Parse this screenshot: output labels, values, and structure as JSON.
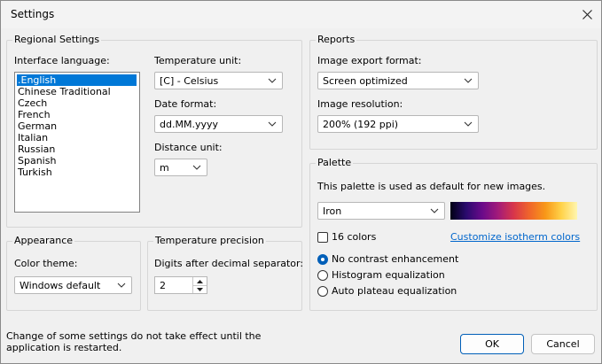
{
  "window": {
    "title": "Settings"
  },
  "regional": {
    "group_label": "Regional Settings",
    "language_label": "Interface language:",
    "languages": [
      ".English",
      "Chinese Traditional",
      "Czech",
      "French",
      "German",
      "Italian",
      "Russian",
      "Spanish",
      "Turkish"
    ],
    "temp_unit_label": "Temperature unit:",
    "temp_unit_value": "[C] - Celsius",
    "date_format_label": "Date format:",
    "date_format_value": "dd.MM.yyyy",
    "distance_unit_label": "Distance unit:",
    "distance_unit_value": "m"
  },
  "appearance": {
    "group_label": "Appearance",
    "theme_label": "Color theme:",
    "theme_value": "Windows default"
  },
  "precision": {
    "group_label": "Temperature precision",
    "digits_label": "Digits after decimal separator:",
    "digits_value": "2"
  },
  "reports": {
    "group_label": "Reports",
    "export_label": "Image export format:",
    "export_value": "Screen optimized",
    "resolution_label": "Image resolution:",
    "resolution_value": "200% (192 ppi)"
  },
  "palette": {
    "group_label": "Palette",
    "description": "This palette is used as default for new images.",
    "palette_value": "Iron",
    "colors16_label": "16 colors",
    "colors16_checked": false,
    "customize_link": "Customize isotherm colors",
    "contrast_options": [
      "No contrast enhancement",
      "Histogram equalization",
      "Auto plateau equalization"
    ],
    "contrast_selected": "No contrast enhancement"
  },
  "footer": {
    "note": "Change of some settings do not take effect until the application is restarted.",
    "ok_label": "OK",
    "cancel_label": "Cancel"
  },
  "colors": {
    "accent": "#0078d7",
    "link": "#0066cc"
  }
}
